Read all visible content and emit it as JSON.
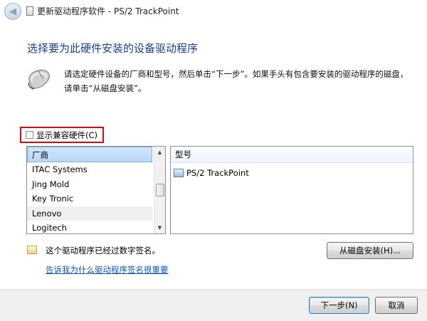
{
  "window": {
    "title": "更新驱动程序软件 - PS/2 TrackPoint"
  },
  "main": {
    "heading": "选择要为此硬件安装的设备驱动程序",
    "description": "请选定硬件设备的厂商和型号，然后单击“下一步”。如果手头有包含要安装的驱动程序的磁盘，请单击“从磁盘安装”。"
  },
  "compat": {
    "label": "显示兼容硬件(C)",
    "checked": false
  },
  "manufacturers": {
    "header": "厂商",
    "items": [
      "ITAC Systems",
      "Jing Mold",
      "Key Tronic",
      "Lenovo",
      "Logitech"
    ],
    "selected": "Lenovo"
  },
  "models": {
    "header": "型号",
    "items": [
      "PS/2 TrackPoint"
    ]
  },
  "signature": {
    "status": "这个驱动程序已经过数字签名。",
    "link": "告诉我为什么驱动程序签名很重要"
  },
  "buttons": {
    "have_disk": "从磁盘安装(H)...",
    "next": "下一步(N)",
    "cancel": "取消"
  },
  "icons": {
    "back": "back-arrow-icon",
    "title": "device-icon",
    "mouse": "mouse-icon",
    "model": "device-driver-icon",
    "signed": "signed-certificate-icon"
  }
}
